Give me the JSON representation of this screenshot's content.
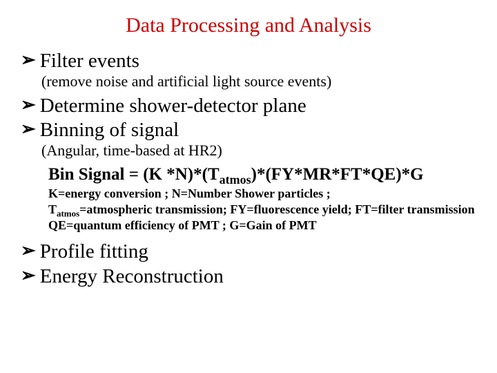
{
  "title": "Data Processing and Analysis",
  "bullets": {
    "b1": "Filter events",
    "b1_sub": "(remove noise and artificial light source events)",
    "b2": "Determine shower-detector plane",
    "b3": "Binning of signal",
    "b3_sub": "(Angular, time-based at HR2)",
    "b4": "Profile fitting",
    "b5": "Energy Reconstruction"
  },
  "formula": {
    "pre": "Bin Signal = (K *N)*(T",
    "sub1": "atmos",
    "post": ")*(FY*MR*FT*QE)*G"
  },
  "defs": {
    "line1": "K=energy conversion  ; N=Number Shower particles ;",
    "line2a": "T",
    "line2sub": "atmos",
    "line2b": "=atmospheric transmission; FY=fluorescence yield; FT=filter transmission",
    "line3": "QE=quantum efficiency of PMT ; G=Gain of PMT"
  },
  "glyphs": {
    "chevron": "➢"
  }
}
